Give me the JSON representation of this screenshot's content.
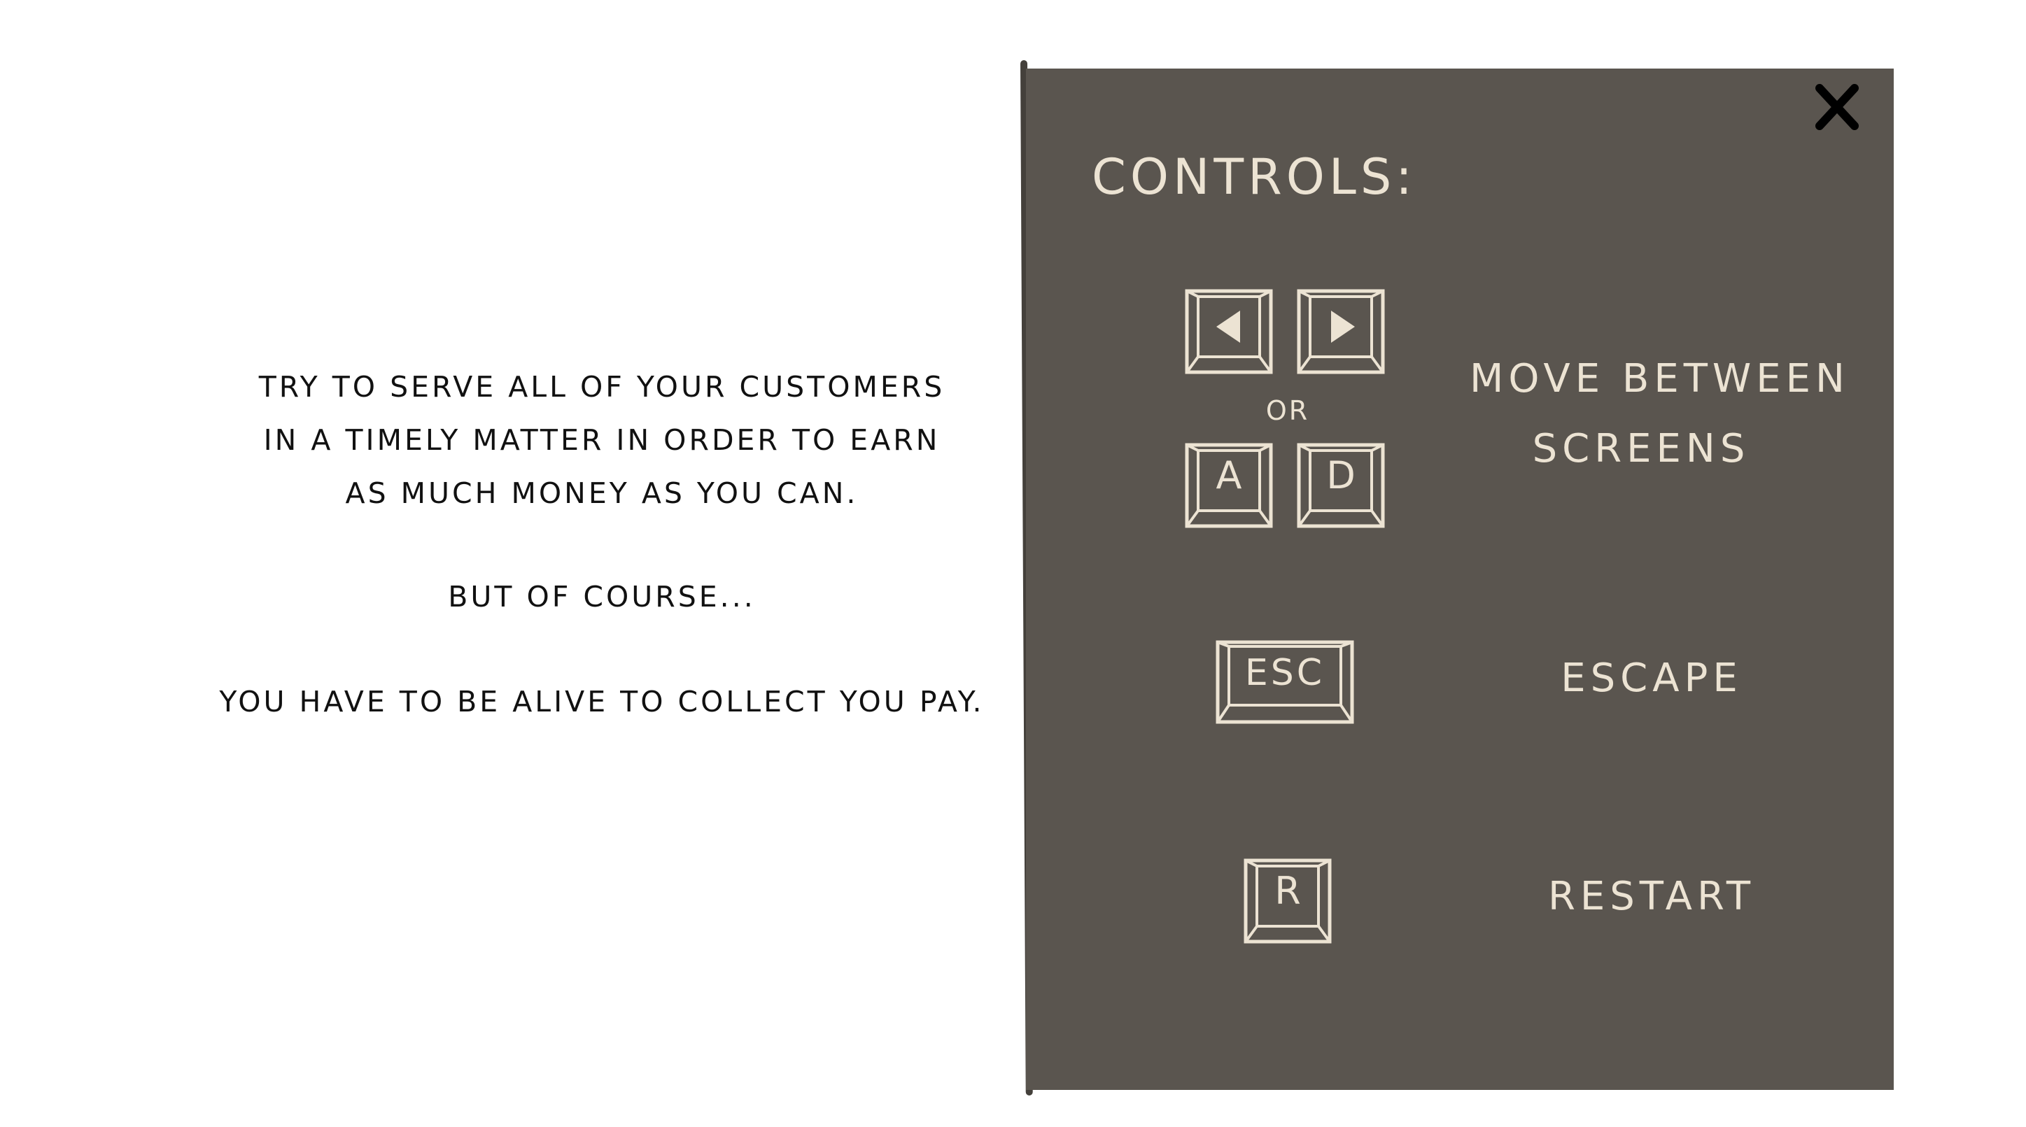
{
  "intro": {
    "line1": "TRY TO SERVE ALL OF YOUR CUSTOMERS",
    "line2": "IN A TIMELY MATTER IN ORDER TO EARN",
    "line3": "AS MUCH MONEY AS YOU CAN.",
    "line4": "BUT OF COURSE...",
    "line5": "YOU HAVE TO BE ALIVE TO COLLECT YOU PAY."
  },
  "controls": {
    "title": "CONTROLS:",
    "or_label": "OR",
    "keys": {
      "left": "left-arrow-icon",
      "right": "right-arrow-icon",
      "a": "A",
      "d": "D",
      "esc": "ESC",
      "r": "R"
    },
    "actions": {
      "move_line1": "MOVE BETWEEN",
      "move_line2": "SCREENS",
      "escape": "ESCAPE",
      "restart": "RESTART"
    }
  },
  "colors": {
    "panel_bg": "#5a554f",
    "panel_text": "#ece3d3",
    "intro_text": "#111111",
    "close_icon": "#000000"
  }
}
